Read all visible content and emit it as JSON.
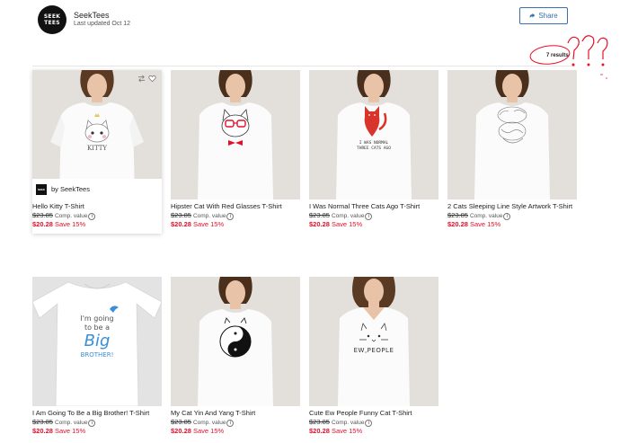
{
  "store": {
    "logo_text_top": "SEEK",
    "logo_text_bottom": "TEES",
    "name": "SeekTees",
    "updated": "Last updated Oct 12"
  },
  "toolbar": {
    "share_label": "Share"
  },
  "results_label": "7 results",
  "seller_strip": {
    "label": "by SeekTees",
    "mini_logo": "SEEK"
  },
  "products": [
    {
      "title": "Hello Kitty T-Shirt",
      "original_price": "$23.85",
      "comp_label": "Comp. value",
      "sale_price": "$20.28",
      "save_label": "Save 15%",
      "design": "kitty-with-crown"
    },
    {
      "title": "Hipster Cat With Red Glasses T-Shirt",
      "original_price": "$23.85",
      "comp_label": "Comp. value",
      "sale_price": "$20.28",
      "save_label": "Save 15%",
      "design": "hipster-cat"
    },
    {
      "title": "I Was Normal Three Cats Ago T-Shirt",
      "original_price": "$23.85",
      "comp_label": "Comp. value",
      "sale_price": "$20.28",
      "save_label": "Save 15%",
      "design": "red-cat",
      "shirt_text_1": "I WAS NORMAL",
      "shirt_text_2": "THREE CATS AGO"
    },
    {
      "title": "2 Cats Sleeping Line Style Artwork T-Shirt",
      "original_price": "$23.85",
      "comp_label": "Comp. value",
      "sale_price": "$20.28",
      "save_label": "Save 15%",
      "design": "sleeping-cats"
    },
    {
      "title": "I Am Going To Be a Big Brother! T-Shirt",
      "original_price": "$23.85",
      "comp_label": "Comp. value",
      "sale_price": "$20.28",
      "save_label": "Save 15%",
      "design": "big-brother",
      "shirt_text_1": "I'm going",
      "shirt_text_2": "to be a",
      "shirt_text_3": "Big",
      "shirt_text_4": "BROTHER!"
    },
    {
      "title": "My Cat Yin And Yang T-Shirt",
      "original_price": "$23.85",
      "comp_label": "Comp. value",
      "sale_price": "$20.28",
      "save_label": "Save 15%",
      "design": "yin-yang-cats"
    },
    {
      "title": "Cute Ew People Funny Cat T-Shirt",
      "original_price": "$23.85",
      "comp_label": "Comp. value",
      "sale_price": "$20.28",
      "save_label": "Save 15%",
      "design": "ew-people",
      "shirt_text_1": "EW,PEOPLE"
    }
  ],
  "colors": {
    "accent": "#3a6fb0",
    "sale": "#e0102a",
    "annotation": "#e8102a",
    "image_bg": "#e3e0dc"
  },
  "annotation": {
    "text": "???"
  }
}
